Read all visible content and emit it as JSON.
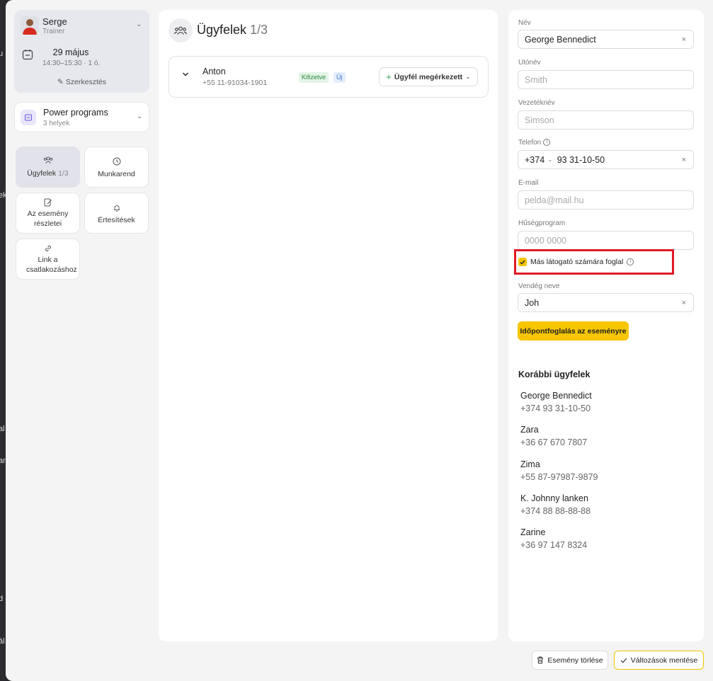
{
  "profile": {
    "name": "Serge",
    "role": "Trainer",
    "date": "29 május",
    "time": "14:30–15:30 · 1 ó.",
    "edit_label": "Szerkesztés"
  },
  "program": {
    "title": "Power programs",
    "subtitle": "3 helyek"
  },
  "tiles": [
    {
      "label": "Ügyfelek",
      "count": "1/3"
    },
    {
      "label": "Munkarend"
    },
    {
      "label": "Az esemény részletei"
    },
    {
      "label": "Értesítések"
    },
    {
      "label": "Link a csatlakozáshoz"
    }
  ],
  "clients": {
    "title": "Ügyfelek",
    "count": "1/3",
    "items": [
      {
        "name": "Anton",
        "phone": "+55 11-91034-1901",
        "badge_paid": "Kifizetve",
        "badge_new": "Új",
        "action": "Ügyfél megérkezett"
      }
    ]
  },
  "form": {
    "name_label": "Név",
    "name_value": "George Bennedict",
    "first_label": "Utónév",
    "first_placeholder": "Smith",
    "last_label": "Vezetéknév",
    "last_placeholder": "Simson",
    "phone_label": "Telefon",
    "phone_code": "+374",
    "phone_value": "93 31-10-50",
    "email_label": "E-mail",
    "email_placeholder": "pelda@mail.hu",
    "loyalty_label": "Hűségprogram",
    "loyalty_placeholder": "0000 0000",
    "checkbox_label": "Más látogató számára foglal",
    "checkbox_checked": true,
    "guest_label": "Vendég neve",
    "guest_value": "Joh",
    "book_button": "Időpontfoglalás az eseményre"
  },
  "previous": {
    "title": "Korábbi ügyfelek",
    "items": [
      {
        "name": "George Bennedict",
        "phone": "+374 93 31-10-50"
      },
      {
        "name": "Zara",
        "phone": "+36 67 670 7807"
      },
      {
        "name": "Zima",
        "phone": "+55 87-97987-9879"
      },
      {
        "name": "K. Johnny lanken",
        "phone": "+374 88 88-88-88"
      },
      {
        "name": "Zarine",
        "phone": "+36 97 147 8324"
      }
    ]
  },
  "footer": {
    "delete_label": "Esemény törlése",
    "save_label": "Változások mentése"
  },
  "colors": {
    "accent": "#f7c600",
    "highlight": "#e01b24",
    "paid": "#2e8b43",
    "new": "#3a6fd1"
  }
}
